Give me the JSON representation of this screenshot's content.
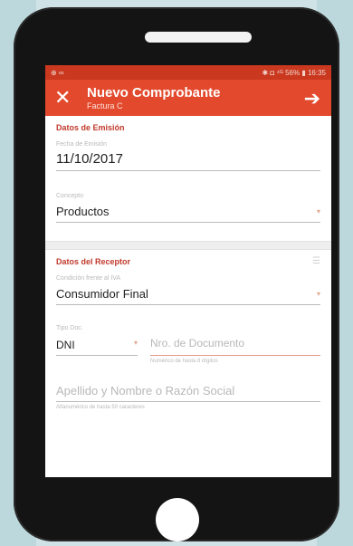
{
  "status_bar": {
    "left": "⊕ ∞",
    "right": "✱ ◘ ⁴ᴳ 56% ▮ 16:35"
  },
  "app_bar": {
    "title": "Nuevo Comprobante",
    "subtitle": "Factura C"
  },
  "emision": {
    "section_title": "Datos de Emisión",
    "fecha_label": "Fecha de Emisión",
    "fecha_value": "11/10/2017",
    "concepto_label": "Concepto",
    "concepto_value": "Productos"
  },
  "receptor": {
    "section_title": "Datos del Receptor",
    "condicion_label": "Condición frente al IVA",
    "condicion_value": "Consumidor Final",
    "tipo_label": "Tipo Doc.",
    "tipo_value": "DNI",
    "nro_placeholder": "Nro. de Documento",
    "nro_hint": "Numérico de hasta 8 dígitos",
    "nombre_placeholder": "Apellido y Nombre o Razón Social",
    "nombre_hint": "Alfanumérico de hasta 50 caracteres"
  },
  "colors": {
    "app_bar": "#e34a2d",
    "status_bar": "#c9381f",
    "section_title": "#c0392b"
  }
}
